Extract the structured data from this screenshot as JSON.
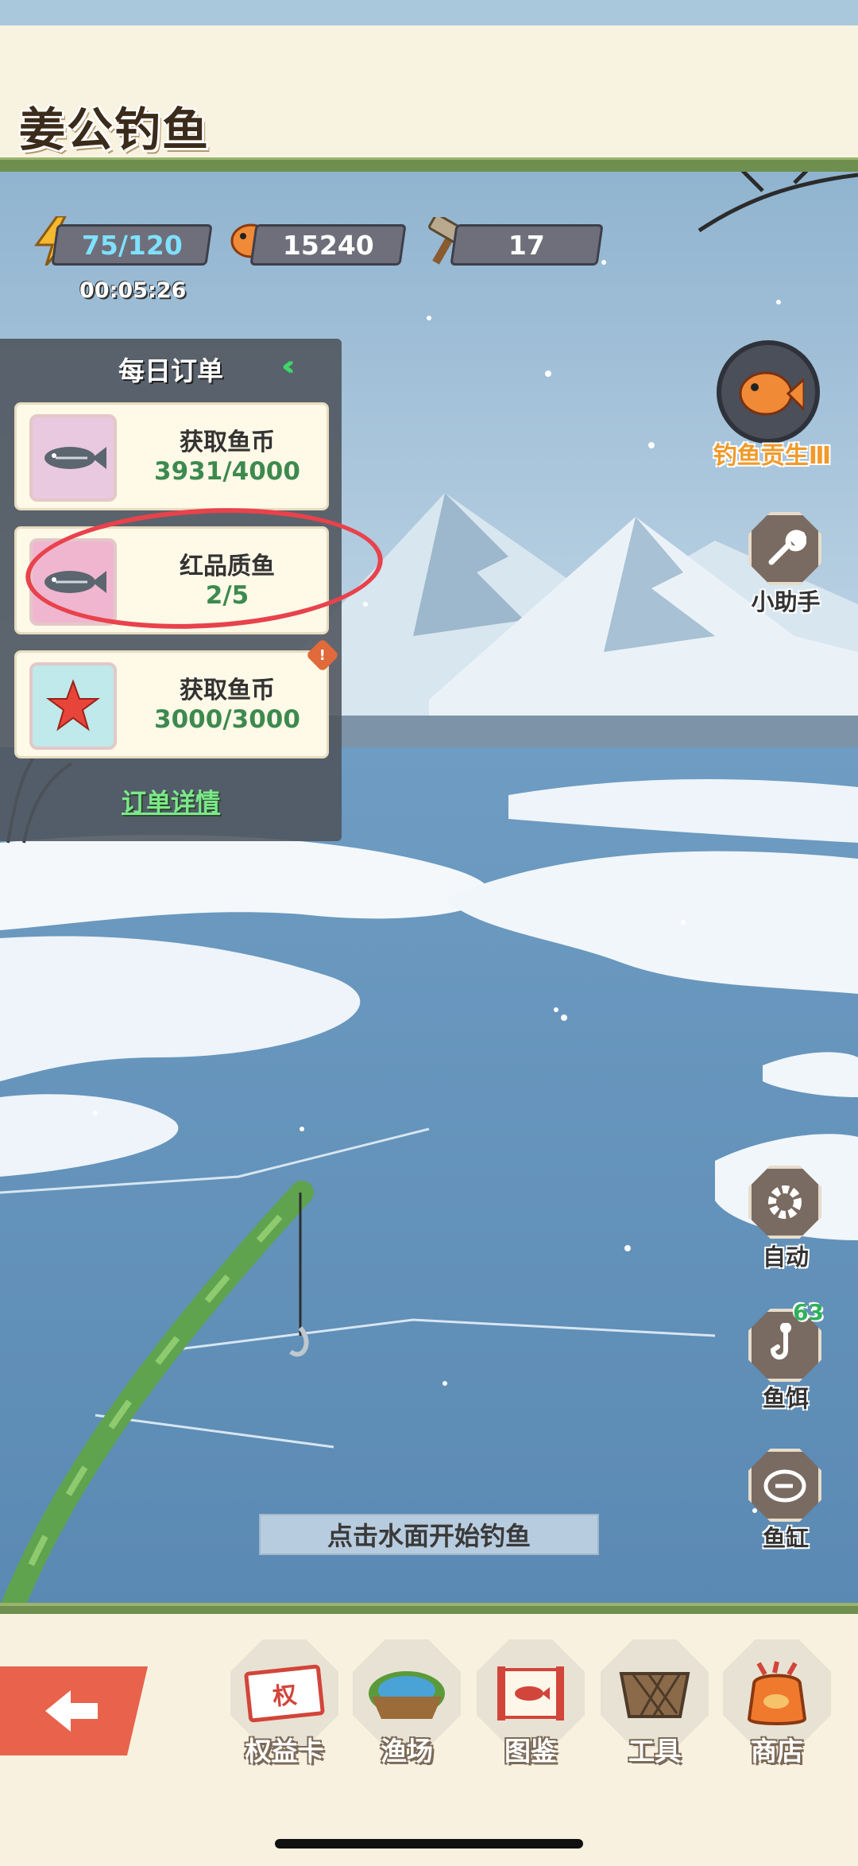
{
  "app": {
    "title": "姜公钓鱼"
  },
  "resources": {
    "energy": "75/120",
    "energy_timer": "00:05:26",
    "coins": "15240",
    "hammers": "17"
  },
  "orders": {
    "title": "每日订单",
    "items": [
      {
        "name": "获取鱼币",
        "progress": "3931/4000",
        "icon": "fish-icon"
      },
      {
        "name": "红品质鱼",
        "progress": "2/5",
        "icon": "fish-icon"
      },
      {
        "name": "获取鱼币",
        "progress": "3000/3000",
        "icon": "starfish-icon",
        "alert": "!"
      }
    ],
    "details_label": "订单详情"
  },
  "side": {
    "rank_label": "钓鱼贡生Ⅲ",
    "helper_label": "小助手",
    "auto_label": "自动",
    "bait_label": "鱼饵",
    "bait_count": "63",
    "tank_label": "鱼缸"
  },
  "hint": "点击水面开始钓鱼",
  "nav": [
    {
      "label": "权益卡",
      "icon": "card-icon",
      "badge_text": "权"
    },
    {
      "label": "渔场",
      "icon": "island-icon"
    },
    {
      "label": "图鉴",
      "icon": "scroll-icon"
    },
    {
      "label": "工具",
      "icon": "basket-icon"
    },
    {
      "label": "商店",
      "icon": "shop-bag-icon"
    }
  ],
  "colors": {
    "accent_green": "#6e8f4e",
    "progress_green": "#3d8a4e",
    "annotation_red": "#e8424c"
  }
}
